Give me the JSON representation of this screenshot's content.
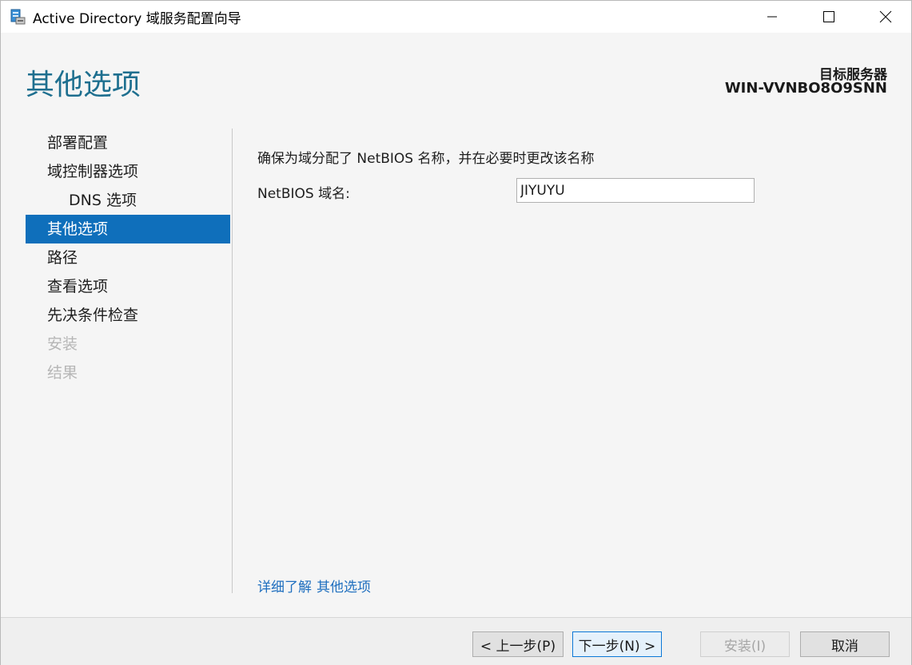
{
  "window": {
    "title": "Active Directory 域服务配置向导"
  },
  "header": {
    "page_title": "其他选项",
    "target_label": "目标服务器",
    "target_value": "WIN-VVNBO8O9SNN"
  },
  "nav": {
    "items": [
      {
        "label": "部署配置",
        "state": "normal"
      },
      {
        "label": "域控制器选项",
        "state": "normal"
      },
      {
        "label": "DNS 选项",
        "state": "sub"
      },
      {
        "label": "其他选项",
        "state": "active"
      },
      {
        "label": "路径",
        "state": "normal"
      },
      {
        "label": "查看选项",
        "state": "normal"
      },
      {
        "label": "先决条件检查",
        "state": "normal"
      },
      {
        "label": "安装",
        "state": "disabled"
      },
      {
        "label": "结果",
        "state": "disabled"
      }
    ]
  },
  "content": {
    "description": "确保为域分配了 NetBIOS 名称，并在必要时更改该名称",
    "netbios_label": "NetBIOS 域名:",
    "netbios_value": "JIYUYU",
    "learn_more_prefix": "详细了解",
    "learn_more_topic": "其他选项"
  },
  "footer": {
    "prev_label": "< 上一步(P)",
    "next_label": "下一步(N) >",
    "install_label": "安装(I)",
    "cancel_label": "取消"
  },
  "colors": {
    "accent": "#0f6fbb",
    "title": "#1e6f8f",
    "link": "#1f6fbf",
    "disabled": "#b6b6b6"
  },
  "icons": {
    "app": "server-icon",
    "minimize": "minimize-icon",
    "maximize": "maximize-icon",
    "close": "close-icon"
  }
}
